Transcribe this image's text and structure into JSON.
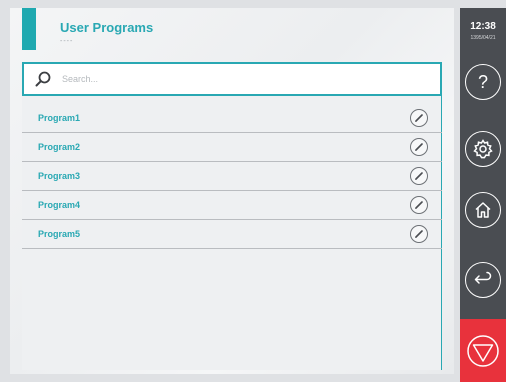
{
  "header": {
    "title": "User Programs",
    "subtitle": "----"
  },
  "search": {
    "placeholder": "Search..."
  },
  "programs": [
    {
      "name": "Program1"
    },
    {
      "name": "Program2"
    },
    {
      "name": "Program3"
    },
    {
      "name": "Program4"
    },
    {
      "name": "Program5"
    }
  ],
  "status": {
    "time": "12:38",
    "date": "1395/04/21"
  },
  "sidebar": {
    "help_label": "?"
  },
  "icons": {
    "search": "search-icon",
    "edit": "pencil-icon",
    "help": "question-icon",
    "settings": "gear-icon",
    "home": "home-icon",
    "back": "back-arrow-icon",
    "stop": "stop-icon"
  },
  "colors": {
    "accent": "#29a8b3",
    "sidebar": "#4a4d52",
    "stop": "#e8323c"
  }
}
